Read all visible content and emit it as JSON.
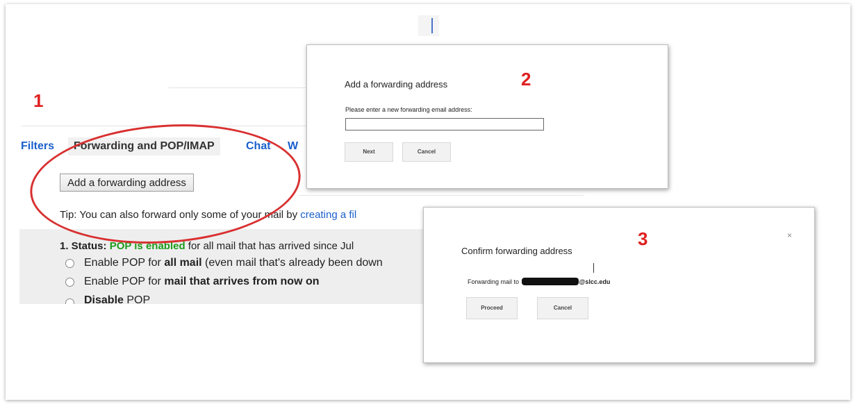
{
  "markers": {
    "one": "1",
    "two": "2",
    "three": "3"
  },
  "tabs": [
    {
      "label": "Filters"
    },
    {
      "label": "Forwarding and POP/IMAP"
    },
    {
      "label": "Chat"
    },
    {
      "label": "W"
    }
  ],
  "forwarding": {
    "add_button": "Add a forwarding address",
    "tip_prefix": "Tip: You can also forward only some of your mail by",
    "tip_link": "creating a fil"
  },
  "pop": {
    "status_label": "1. Status:",
    "status_value": "POP is enabled",
    "status_suffix": "for all mail that has arrived since Jul",
    "options": [
      {
        "pre": "Enable POP for",
        "bold": "all mail",
        "post": "(even mail that's already been down"
      },
      {
        "pre": "Enable POP for",
        "bold": "mail that arrives from now on",
        "post": ""
      },
      {
        "pre": "",
        "bold": "Disable",
        "post": "POP"
      }
    ]
  },
  "dialog_add": {
    "title": "Add a forwarding address",
    "label": "Please enter a new forwarding email address:",
    "input_value": "",
    "next": "Next",
    "cancel": "Cancel"
  },
  "dialog_confirm": {
    "title": "Confirm forwarding address",
    "text_prefix": "Forwarding mail to",
    "email_domain": "@slcc.edu",
    "proceed": "Proceed",
    "cancel": "Cancel",
    "close": "×"
  },
  "colors": {
    "marker": "#e02020",
    "link": "#1a5fcc",
    "pop_enabled": "#1b9c1b",
    "ellipse": "#d93030"
  }
}
